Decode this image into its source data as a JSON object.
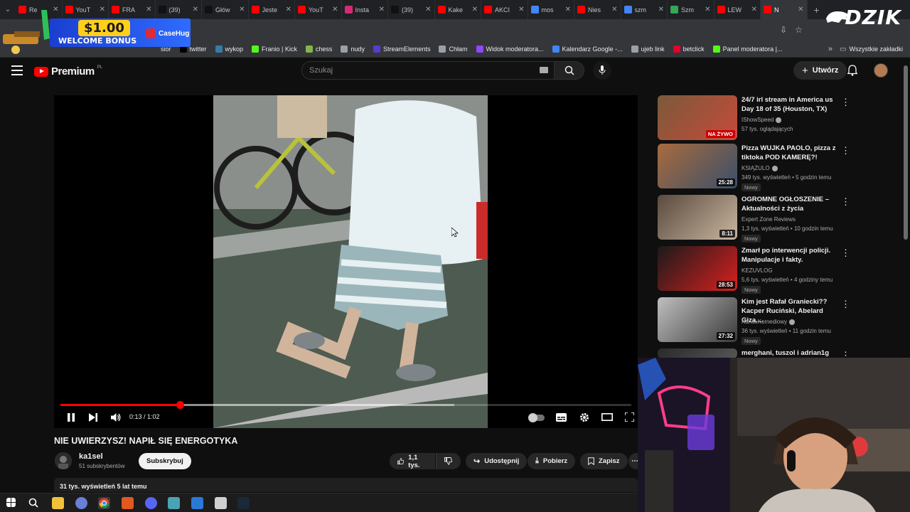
{
  "browser": {
    "tabs": [
      {
        "label": "Re",
        "color": "#ff0000"
      },
      {
        "label": "YouT",
        "color": "#ff0000"
      },
      {
        "label": "FRA",
        "color": "#ff0000"
      },
      {
        "label": "(39)",
        "color": "#111111"
      },
      {
        "label": "Głów",
        "color": "#111111"
      },
      {
        "label": "Jeste",
        "color": "#ff0000"
      },
      {
        "label": "YouT",
        "color": "#ff0000"
      },
      {
        "label": "Insta",
        "color": "#d62976"
      },
      {
        "label": "(39)",
        "color": "#111111"
      },
      {
        "label": "Kake",
        "color": "#ff0000"
      },
      {
        "label": "AKCI",
        "color": "#ff0000"
      },
      {
        "label": "mos",
        "color": "#4285f4"
      },
      {
        "label": "Nies",
        "color": "#ff0000"
      },
      {
        "label": "szm",
        "color": "#4285f4"
      },
      {
        "label": "Szm",
        "color": "#34a853"
      },
      {
        "label": "LEW",
        "color": "#ff0000"
      },
      {
        "label": "N",
        "color": "#ff0000",
        "active": true
      }
    ],
    "bookmarks": [
      {
        "label": "twitter",
        "color": "#000000"
      },
      {
        "label": "wykop",
        "color": "#367da6"
      },
      {
        "label": "Franio | Kick",
        "color": "#53fc18"
      },
      {
        "label": "chess",
        "color": "#81b64c"
      },
      {
        "label": "nudy",
        "color": "#9aa0a6"
      },
      {
        "label": "StreamElements",
        "color": "#5b3ad1"
      },
      {
        "label": "Chłam",
        "color": "#9aa0a6"
      },
      {
        "label": "Widok moderatora...",
        "color": "#9146ff"
      },
      {
        "label": "Kalendarz Google -...",
        "color": "#4285f4"
      },
      {
        "label": "ujeb link",
        "color": "#9aa0a6"
      },
      {
        "label": "betclick",
        "color": "#e4002b"
      },
      {
        "label": "Panel moderatora |...",
        "color": "#53fc18"
      }
    ],
    "bookmarks_all": "Wszystkie zakładki",
    "bookmark_partial": "sior"
  },
  "overlay": {
    "promo_amount": "$1.00",
    "promo_text": "WELCOME BONUS",
    "promo_brand": "CaseHug",
    "streamer_logo": "DZIK"
  },
  "youtube": {
    "logo": "Premium",
    "logo_region": "PL",
    "search_placeholder": "Szukaj",
    "create_label": "Utwórz",
    "player": {
      "time": "0:13 / 1:02",
      "progress": 0.2097,
      "buffered": 0.69
    },
    "video": {
      "title": "NIE UWIERZYSZ! NAPIŁ SIĘ ENERGOTYKA",
      "channel": "ka1sel",
      "subscribers": "51 subskrybentów",
      "subscribe_label": "Subskrybuj",
      "likes": "1,1 tys.",
      "share_label": "Udostępnij",
      "download_label": "Pobierz",
      "save_label": "Zapisz",
      "views_date": "31 tys. wyświetleń  5 lat temu"
    },
    "recommendations": [
      {
        "title": "24/7 irl stream in America us Day 18 of 35 (Houston, TX)",
        "channel": "IShowSpeed",
        "verified": true,
        "meta": "57 tys. oglądających",
        "badge": "NA ŻYWO",
        "live": true,
        "new": ""
      },
      {
        "title": "Pizza WUJKA PAOLO, pizza z tiktoka POD KAMERĘ?!",
        "channel": "KSIĄŻULO",
        "verified": true,
        "meta": "349 tys. wyświetleń • 5 godzin temu",
        "badge": "25:28",
        "live": false,
        "new": "Nowy"
      },
      {
        "title": "OGROMNE OGŁOSZENIE – Aktualności z życia",
        "channel": "Expert Zone Reviews",
        "verified": false,
        "meta": "1,3 tys. wyświetleń • 10 godzin temu",
        "badge": "8:11",
        "live": false,
        "new": "Nowy"
      },
      {
        "title": "Zmarł po interwencji policji. Manipulacje i fakty.",
        "channel": "KEZUVLOG",
        "verified": false,
        "meta": "5,6 tys. wyświetleń • 4 godziny temu",
        "badge": "28:53",
        "live": false,
        "new": "Nowy"
      },
      {
        "title": "Kim jest Rafał Graniecki?? Kacper Ruciński, Abelard Giza,...",
        "channel": "Kanał Komediowy",
        "verified": true,
        "meta": "36 tys. wyświetleń • 11 godzin temu",
        "badge": "27:32",
        "live": false,
        "new": "Nowy"
      },
      {
        "title": "merghani, tuszol i adrian1g",
        "channel": "",
        "verified": false,
        "meta": "",
        "badge": "",
        "live": false,
        "new": ""
      }
    ]
  }
}
